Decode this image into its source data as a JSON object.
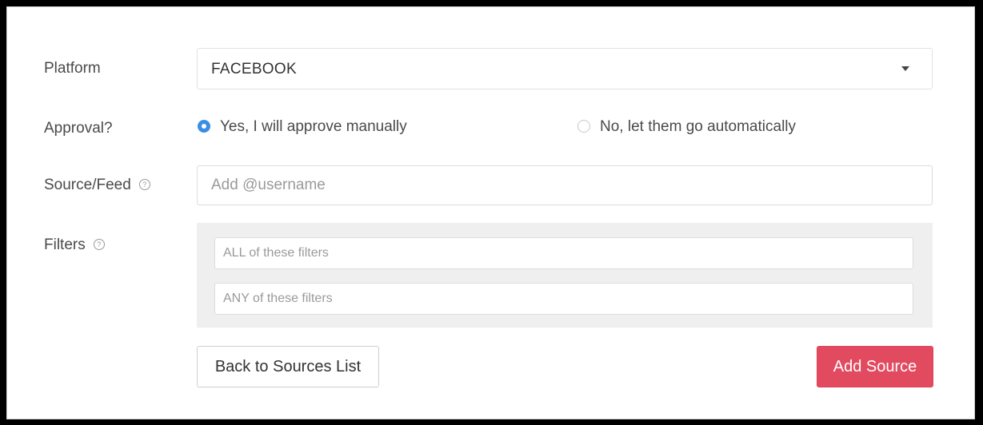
{
  "platform": {
    "label": "Platform",
    "selected": "FACEBOOK",
    "caret_icon": "caret-down-icon"
  },
  "approval": {
    "label": "Approval?",
    "options": [
      {
        "label": "Yes, I will approve manually",
        "checked": true
      },
      {
        "label": "No, let them go automatically",
        "checked": false
      }
    ]
  },
  "source": {
    "label": "Source/Feed",
    "help_icon": "help-circle-icon",
    "placeholder": "Add @username",
    "value": ""
  },
  "filters": {
    "label": "Filters",
    "help_icon": "help-circle-icon",
    "all_placeholder": "ALL of these filters",
    "any_placeholder": "ANY of these filters"
  },
  "actions": {
    "back_label": "Back to Sources List",
    "add_label": "Add Source"
  },
  "colors": {
    "accent": "#3a8ee6",
    "primary_button": "#e14a5f",
    "filter_panel": "#efefef"
  }
}
